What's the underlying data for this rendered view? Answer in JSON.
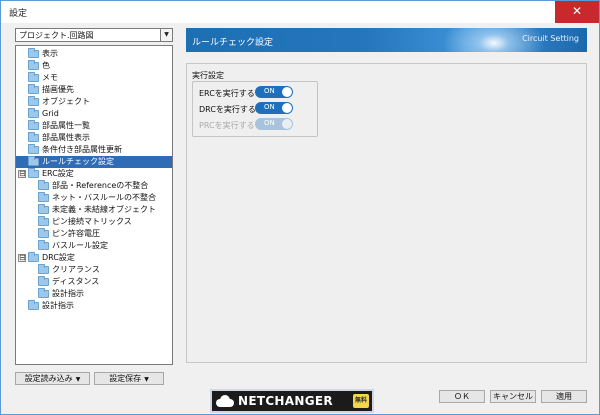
{
  "window": {
    "title": "設定",
    "close_glyph": "✕"
  },
  "project_select": {
    "value": "プロジェクト.回路図",
    "arrow": "▼"
  },
  "tree": [
    {
      "label": "表示"
    },
    {
      "label": "色"
    },
    {
      "label": "メモ"
    },
    {
      "label": "描画優先"
    },
    {
      "label": "オブジェクト"
    },
    {
      "label": "Grid"
    },
    {
      "label": "部品属性一覧"
    },
    {
      "label": "部品属性表示"
    },
    {
      "label": "条件付き部品属性更新"
    },
    {
      "label": "ルールチェック設定"
    },
    {
      "label": "ERC設定",
      "toggle": "⊟"
    },
    {
      "label": "部品・Referenceの不整合"
    },
    {
      "label": "ネット・バスルールの不整合"
    },
    {
      "label": "未定義・未結線オブジェクト"
    },
    {
      "label": "ピン接続マトリックス"
    },
    {
      "label": "ピン許容電圧"
    },
    {
      "label": "バスルール設定"
    },
    {
      "label": "DRC設定",
      "toggle": "⊟"
    },
    {
      "label": "クリアランス"
    },
    {
      "label": "ディスタンス"
    },
    {
      "label": "設計指示"
    },
    {
      "label": "設計指示"
    }
  ],
  "left_buttons": {
    "load": "設定読み込み",
    "save": "設定保存",
    "dd": "▼"
  },
  "banner": {
    "title": "ルールチェック設定",
    "subtitle": "Circuit Setting"
  },
  "panel": {
    "group_label": "実行設定",
    "options": [
      {
        "label": "ERCを実行する",
        "state": "ON"
      },
      {
        "label": "DRCを実行する",
        "state": "ON"
      },
      {
        "label": "PRCを実行する",
        "state": "ON"
      }
    ]
  },
  "logo": {
    "text": "NETCHANGER",
    "badge": "無料"
  },
  "footer_buttons": {
    "ok": "ＯＫ",
    "cancel": "キャンセル",
    "apply": "適用"
  }
}
